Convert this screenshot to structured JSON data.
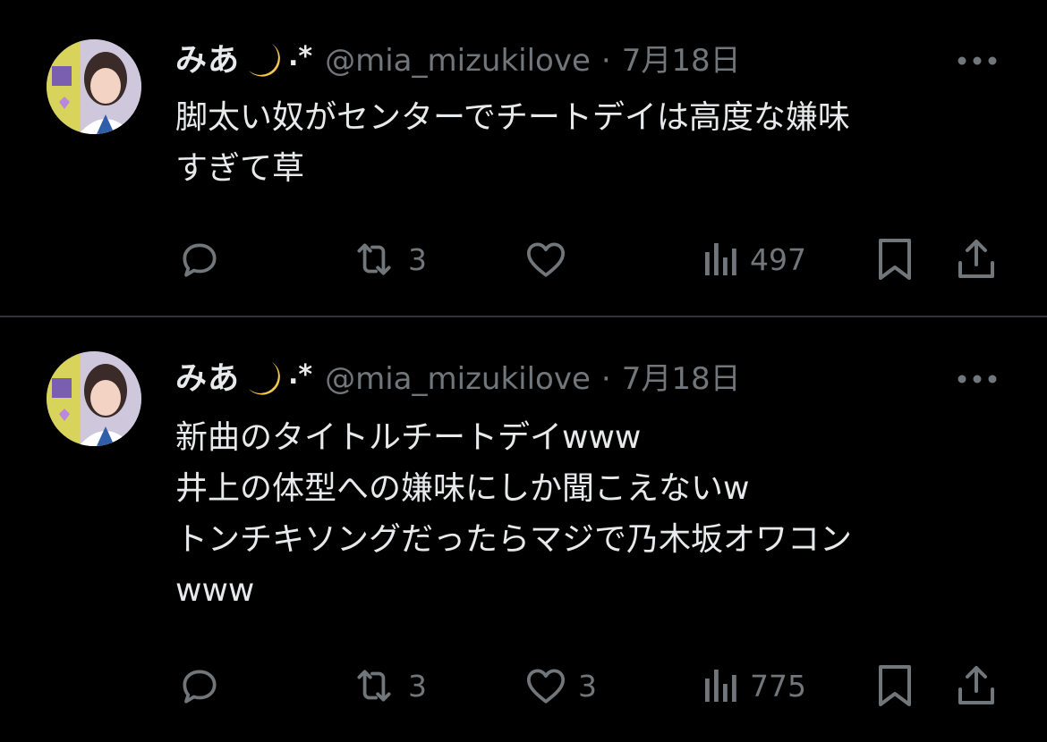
{
  "tweets": [
    {
      "author": {
        "display_name": "みあ",
        "name_emoji": "crescent-moon",
        "name_suffix": ".*",
        "handle": "@mia_mizukilove",
        "separator": "·",
        "date": "7月18日"
      },
      "lines": [
        "脚太い奴がセンターでチートデイは高度な嫌味",
        "すぎて草"
      ],
      "actions": {
        "reply_count": "",
        "retweet_count": "3",
        "like_count": "",
        "view_count": "497"
      }
    },
    {
      "author": {
        "display_name": "みあ",
        "name_emoji": "crescent-moon",
        "name_suffix": ".*",
        "handle": "@mia_mizukilove",
        "separator": "·",
        "date": "7月18日"
      },
      "lines": [
        "新曲のタイトルチートデイwww",
        "井上の体型への嫌味にしか聞こえないw",
        "トンチキソングだったらマジで乃木坂オワコン",
        "www"
      ],
      "actions": {
        "reply_count": "",
        "retweet_count": "3",
        "like_count": "3",
        "view_count": "775"
      }
    }
  ],
  "colors": {
    "background": "#000000",
    "text_primary": "#e7e9ea",
    "text_secondary": "#71767b",
    "divider": "#2f3336"
  }
}
